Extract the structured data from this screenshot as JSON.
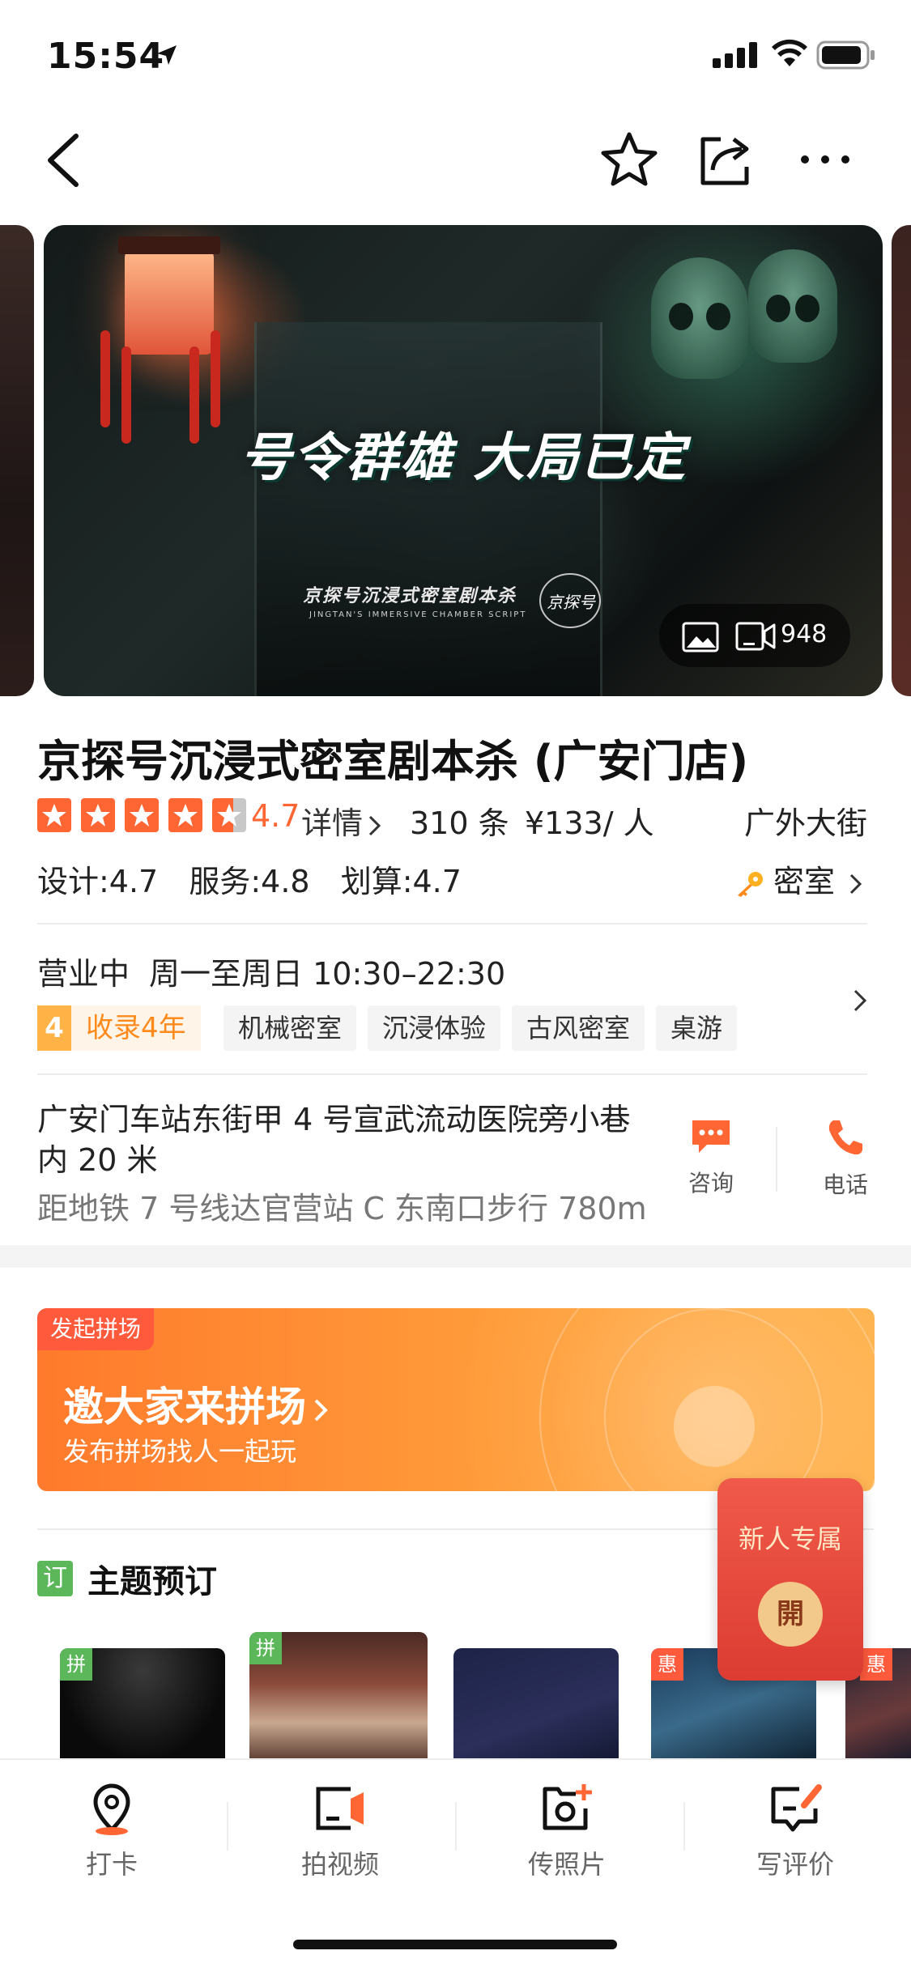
{
  "status_bar": {
    "time": "15:54"
  },
  "gallery": {
    "title": "号令群雄 大局已定",
    "subtitle": "京探号沉浸式密室剧本杀",
    "subtitle_en": "JINGTAN'S IMMERSIVE CHAMBER SCRIPT",
    "logo_text": "京探号",
    "media_count": "948"
  },
  "shop": {
    "name": "京探号沉浸式密室剧本杀 (广安门店)",
    "rating": 4.7,
    "rating_text": "4.7",
    "detail_label": "详情",
    "review_count": "310 条",
    "price": "¥133/ 人",
    "district": "广外大街",
    "subscores": [
      "设计:4.7",
      "服务:4.8",
      "划算:4.7"
    ],
    "category": "密室",
    "status": "营业中",
    "hours": "周一至周日 10:30–22:30",
    "years_num": "4",
    "years_text": "收录4年",
    "tags": [
      "机械密室",
      "沉浸体验",
      "古风密室",
      "桌游"
    ],
    "address": "广安门车站东街甲 4 号宣武流动医院旁小巷内 20 米",
    "metro": "距地铁 7 号线达官营站 C 东南口步行 780m",
    "consult_label": "咨询",
    "phone_label": "电话"
  },
  "group_banner": {
    "tag": "发起拼场",
    "title": "邀大家来拼场",
    "subtitle": "发布拼场找人一起玩"
  },
  "section": {
    "badge": "订",
    "title": "主题预订"
  },
  "thumbnails": [
    {
      "badge": "拼",
      "badge_color": "green"
    },
    {
      "badge": "拼",
      "badge_color": "green"
    },
    {
      "badge": "",
      "badge_color": ""
    },
    {
      "badge": "惠",
      "badge_color": "orange"
    },
    {
      "badge": "惠",
      "badge_color": "orange"
    }
  ],
  "new_user": {
    "title": "新人专属",
    "button": "開"
  },
  "tabbar": {
    "items": [
      {
        "label": "打卡",
        "icon": "location-pin-icon"
      },
      {
        "label": "拍视频",
        "icon": "video-camera-icon"
      },
      {
        "label": "传照片",
        "icon": "add-photo-icon"
      },
      {
        "label": "写评价",
        "icon": "write-review-icon"
      }
    ]
  },
  "colors": {
    "accent": "#ff6633",
    "green": "#5bb75a",
    "banner": "#ff8a2c"
  }
}
